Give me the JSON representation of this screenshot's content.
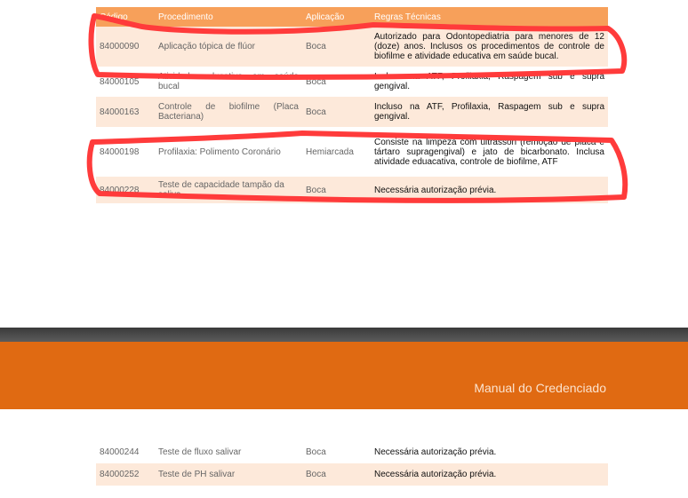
{
  "table": {
    "headers": [
      "Código",
      "Procedimento",
      "Aplicação",
      "Regras Técnicas"
    ],
    "rows": [
      {
        "code": "84000090",
        "procedure": "Aplicação tópica de flúor",
        "application": "Boca",
        "rule": "Autorizado para Odontopediatria para menores de 12 (doze) anos. Inclusos os procedimentos de controle de biofilme e atividade educativa em saúde bucal."
      },
      {
        "code": "84000105",
        "procedure": "Atividade educativa em saúde bucal",
        "application": "Boca",
        "rule": "Incluso na ATF, Profilaxia, Raspagem sub e supra gengival."
      },
      {
        "code": "84000163",
        "procedure": "Controle de biofilme (Placa Bacteriana)",
        "application": "Boca",
        "rule": "Incluso na ATF, Profilaxia, Raspagem sub e supra gengival."
      },
      {
        "code": "84000198",
        "procedure": "Profilaxia: Polimento Coronário",
        "application": "Hemiarcada",
        "rule": "Consiste na limpeza com ultrasson (remoção de placa e tártaro supragengival) e jato de bicarbonato. Inclusa atividade eduacativa, controle de biofilme, ATF"
      },
      {
        "code": "84000228",
        "procedure": "Teste de capacidade tampão da saliva",
        "application": "Boca",
        "rule": "Necessária autorização prévia."
      }
    ]
  },
  "banner": {
    "title": "Manual do Credenciado"
  },
  "table2": {
    "rows": [
      {
        "code": "84000244",
        "procedure": "Teste de fluxo salivar",
        "application": "Boca",
        "rule": "Necessária autorização prévia."
      },
      {
        "code": "84000252",
        "procedure": "Teste de PH salivar",
        "application": "Boca",
        "rule": "Necessária autorização prévia."
      }
    ]
  },
  "colors": {
    "header": "#f7a05a",
    "row_tint": "#fde9da",
    "banner": "#e06a12",
    "annotation": "#ff3b3b"
  }
}
